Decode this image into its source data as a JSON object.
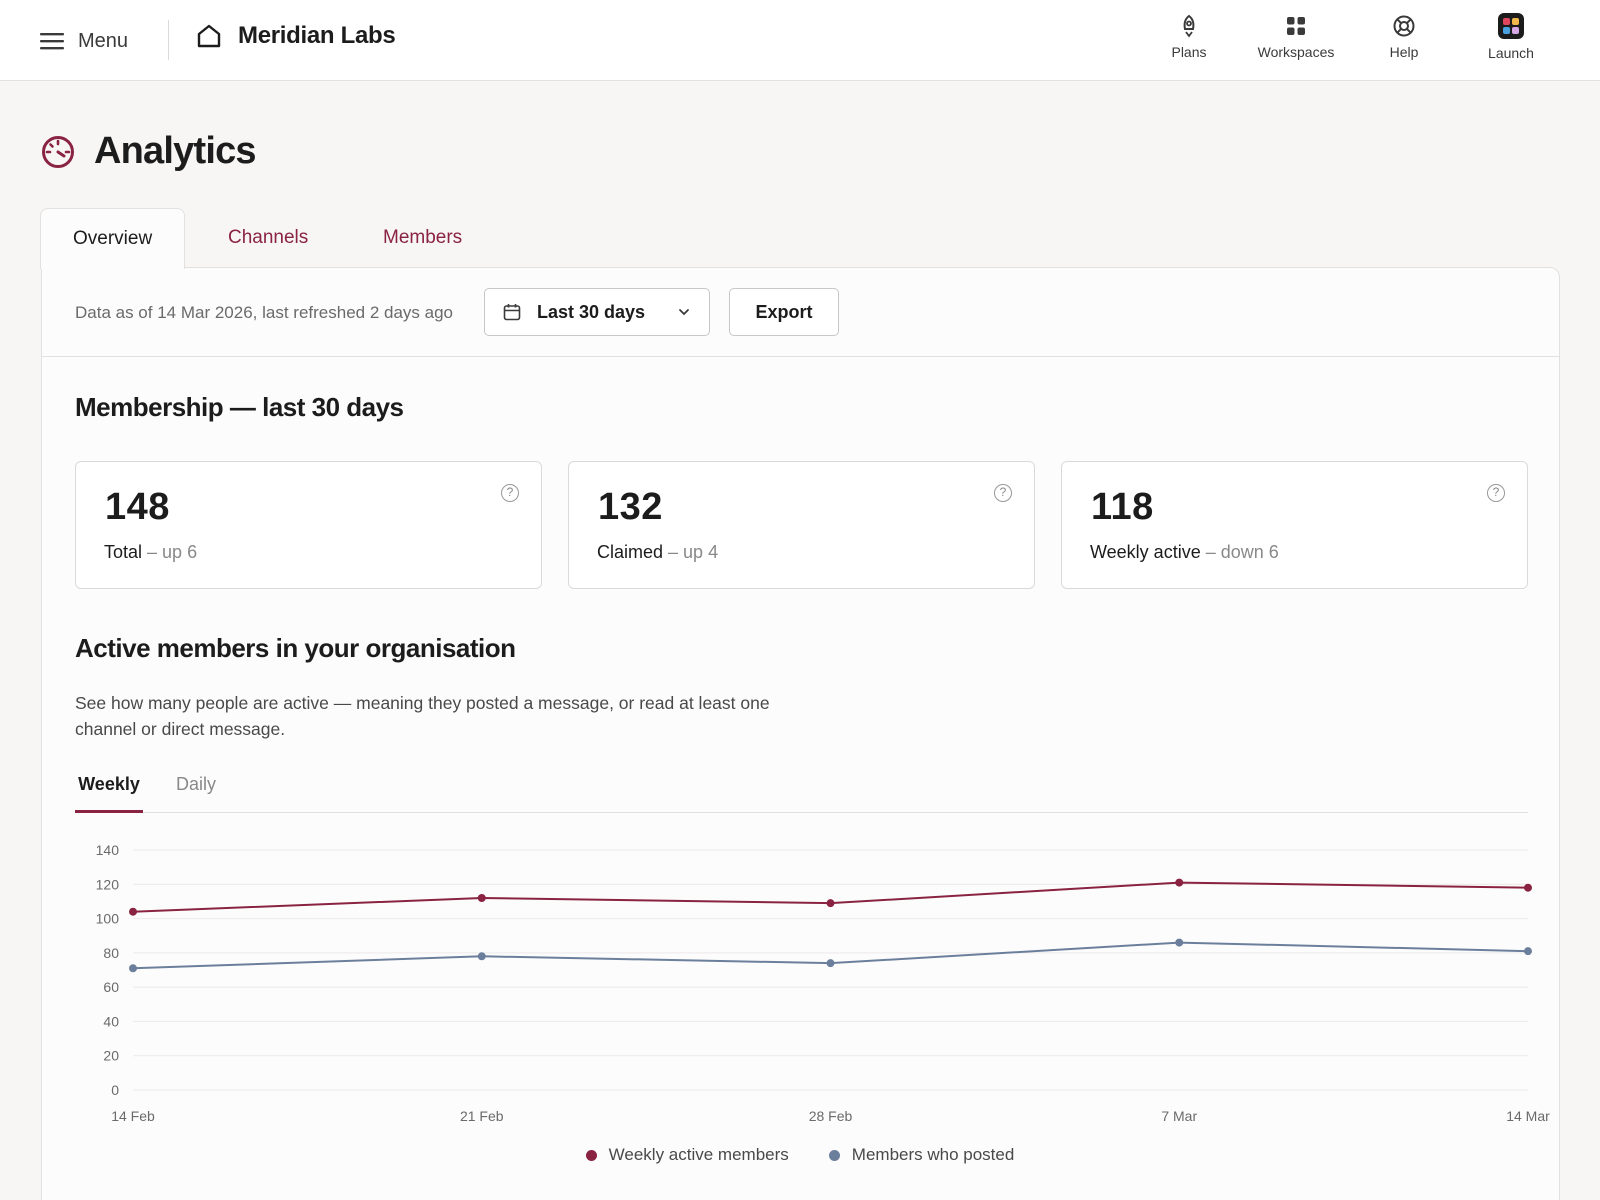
{
  "header": {
    "menu_label": "Menu",
    "brand": "Meridian Labs",
    "nav": [
      {
        "label": "Plans",
        "icon": "rocket-icon"
      },
      {
        "label": "Workspaces",
        "icon": "grid-icon"
      },
      {
        "label": "Help",
        "icon": "lifebuoy-icon"
      },
      {
        "label": "Launch",
        "icon": "app-tile-icon"
      }
    ]
  },
  "page": {
    "title": "Analytics",
    "icon": "gauge-icon",
    "tabs": [
      "Overview",
      "Channels",
      "Members"
    ],
    "active_tab": "Overview"
  },
  "toolbar": {
    "as_of": "Data as of 14 Mar 2026, last refreshed 2 days ago",
    "range": "Last 30 days",
    "export": "Export"
  },
  "membership": {
    "title": "Membership — last 30 days",
    "cards": [
      {
        "value": "148",
        "label": "Total",
        "sep": " – ",
        "delta": "up 6"
      },
      {
        "value": "132",
        "label": "Claimed",
        "sep": " – ",
        "delta": "up 4"
      },
      {
        "value": "118",
        "label": "Weekly active",
        "sep": " – ",
        "delta": "down 6"
      }
    ]
  },
  "active": {
    "title": "Active members in your organisation",
    "description": "See how many people are active — meaning they posted a message, or read at least one channel or direct message.",
    "subtabs": [
      "Weekly",
      "Daily"
    ],
    "active_subtab": "Weekly"
  },
  "colors": {
    "accent": "#8a2342",
    "series_active": "#8a2342",
    "series_posted": "#6b7f9c"
  },
  "chart_data": {
    "type": "line",
    "x": [
      "14 Feb",
      "21 Feb",
      "28 Feb",
      "7 Mar",
      "14 Mar"
    ],
    "series": [
      {
        "name": "Weekly active members",
        "values": [
          104,
          112,
          109,
          121,
          118
        ],
        "color": "#8a2342"
      },
      {
        "name": "Members who posted",
        "values": [
          71,
          78,
          74,
          86,
          81
        ],
        "color": "#6b7f9c"
      }
    ],
    "ylim": [
      0,
      140
    ],
    "yticks": [
      0,
      20,
      40,
      60,
      80,
      100,
      120,
      140
    ],
    "grid": true,
    "legend": "bottom-center"
  }
}
